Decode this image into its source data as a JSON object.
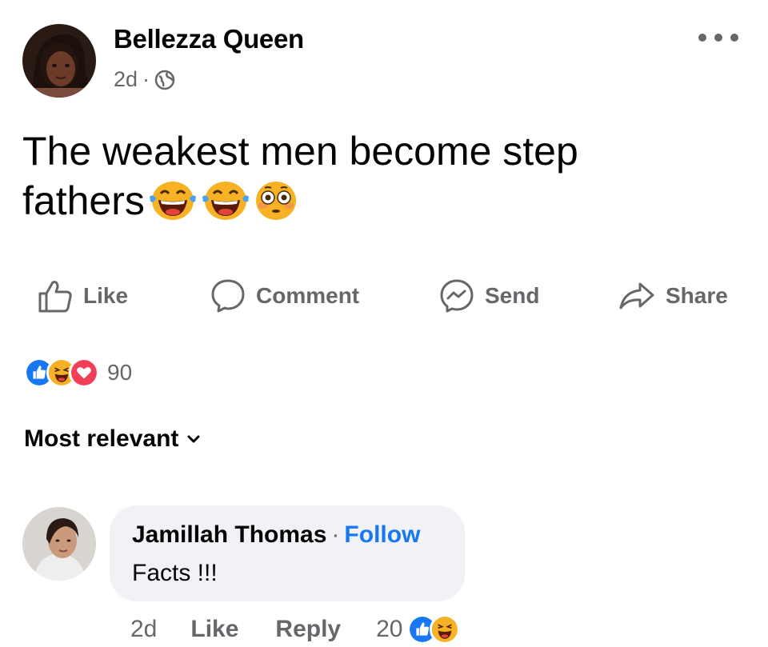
{
  "post": {
    "author": "Bellezza Queen",
    "time": "2d",
    "meta_separator": "·",
    "privacy_icon": "globe-icon",
    "text_line1": "The weakest men become step",
    "text_line2": "fathers",
    "emojis": [
      "face-with-tears-of-joy",
      "face-with-tears-of-joy",
      "flushed-face"
    ]
  },
  "actions": {
    "like": "Like",
    "comment": "Comment",
    "send": "Send",
    "share": "Share"
  },
  "reactions": {
    "icons": [
      "like-icon",
      "haha-icon",
      "love-icon"
    ],
    "count": "90"
  },
  "sort": {
    "label": "Most relevant"
  },
  "comment": {
    "author": "Jamillah Thomas",
    "separator": "·",
    "follow": "Follow",
    "text": "Facts !!!",
    "time": "2d",
    "like": "Like",
    "reply": "Reply",
    "reaction_count": "20",
    "reaction_icons": [
      "like-icon",
      "haha-icon"
    ]
  },
  "colors": {
    "accent": "#1877f2",
    "secondary_text": "#65676b",
    "bubble": "#f0f2f5",
    "love": "#f33e58",
    "emoji_yellow": "#f7b125"
  }
}
